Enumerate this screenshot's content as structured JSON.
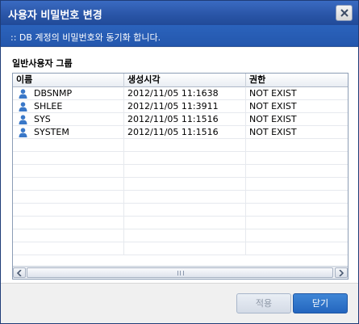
{
  "window": {
    "title": "사용자 비밀번호 변경"
  },
  "info": {
    "text": ":: DB 계정의 비밀번호와 동기화 합니다."
  },
  "section": {
    "title": "일반사용자 그룹"
  },
  "table": {
    "columns": [
      "이름",
      "생성시각",
      "권한"
    ],
    "rows": [
      {
        "name": "DBSNMP",
        "created": "2012/11/05 11:1638",
        "permission": "NOT EXIST"
      },
      {
        "name": "SHLEE",
        "created": "2012/11/05 11:3911",
        "permission": "NOT EXIST"
      },
      {
        "name": "SYS",
        "created": "2012/11/05 11:1516",
        "permission": "NOT EXIST"
      },
      {
        "name": "SYSTEM",
        "created": "2012/11/05 11:1516",
        "permission": "NOT EXIST"
      }
    ]
  },
  "buttons": {
    "apply": "적용",
    "close": "닫기"
  },
  "colors": {
    "title_bar": "#2a56a8",
    "info_band": "#2457ad",
    "user_icon": "#3a78c8",
    "primary_button": "#2466bf"
  },
  "icons": {
    "close": "close-icon",
    "user": "user-icon",
    "scroll_left": "chevron-left-icon",
    "scroll_right": "chevron-right-icon"
  }
}
